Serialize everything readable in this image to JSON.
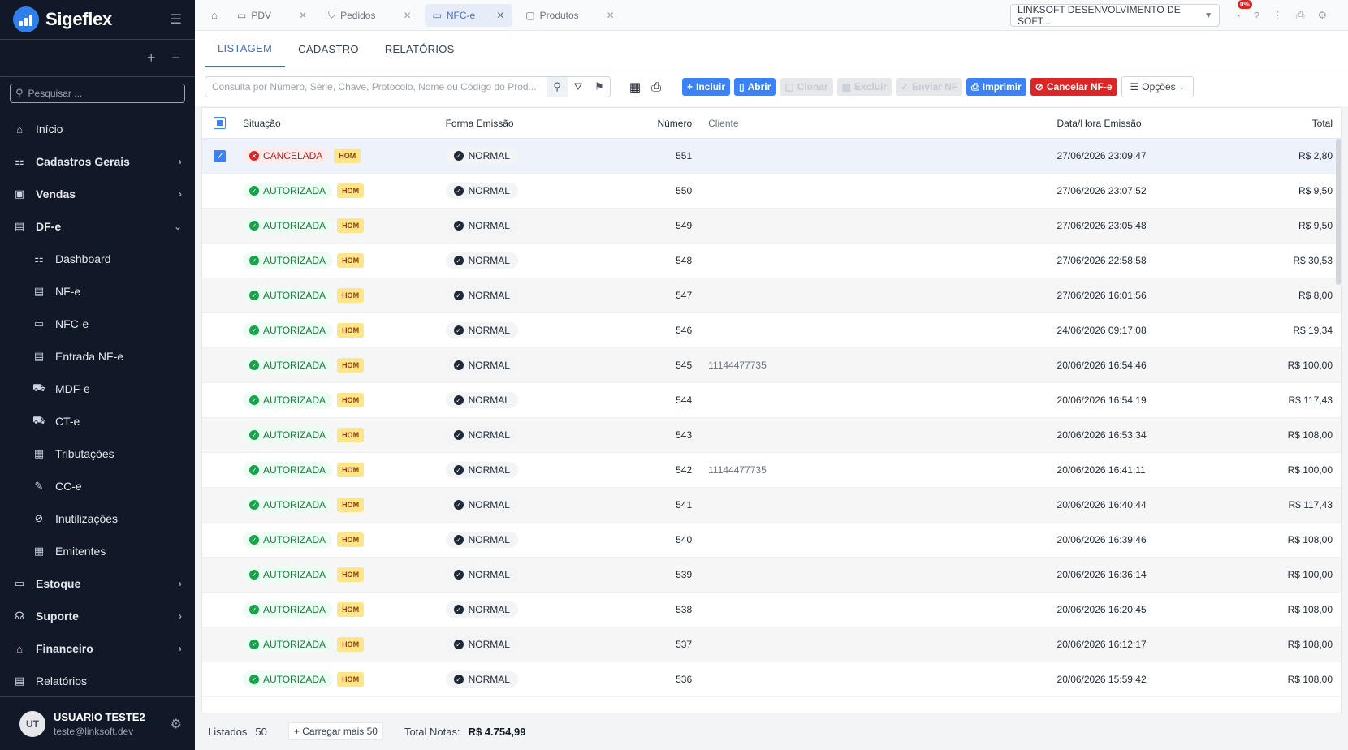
{
  "app": {
    "name": "Sigeflex"
  },
  "sidebar": {
    "search_placeholder": "Pesquisar ...",
    "items": [
      {
        "label": "Início",
        "name": "sidebar-item-inicio",
        "icon": "⌂",
        "bold": false,
        "sub": false,
        "chev": ""
      },
      {
        "label": "Cadastros Gerais",
        "name": "sidebar-item-cadastros-gerais",
        "icon": "⚏",
        "bold": true,
        "sub": false,
        "chev": "›"
      },
      {
        "label": "Vendas",
        "name": "sidebar-item-vendas",
        "icon": "▣",
        "bold": true,
        "sub": false,
        "chev": "›"
      },
      {
        "label": "DF-e",
        "name": "sidebar-item-dfe",
        "icon": "▤",
        "bold": true,
        "sub": false,
        "chev": "⌄"
      },
      {
        "label": "Dashboard",
        "name": "sidebar-item-dashboard",
        "icon": "⚏",
        "bold": false,
        "sub": true,
        "chev": ""
      },
      {
        "label": "NF-e",
        "name": "sidebar-item-nfe",
        "icon": "▤",
        "bold": false,
        "sub": true,
        "chev": ""
      },
      {
        "label": "NFC-e",
        "name": "sidebar-item-nfce",
        "icon": "▭",
        "bold": false,
        "sub": true,
        "chev": ""
      },
      {
        "label": "Entrada NF-e",
        "name": "sidebar-item-entrada-nfe",
        "icon": "▤",
        "bold": false,
        "sub": true,
        "chev": ""
      },
      {
        "label": "MDF-e",
        "name": "sidebar-item-mdfe",
        "icon": "⛟",
        "bold": false,
        "sub": true,
        "chev": ""
      },
      {
        "label": "CT-e",
        "name": "sidebar-item-cte",
        "icon": "⛟",
        "bold": false,
        "sub": true,
        "chev": ""
      },
      {
        "label": "Tributações",
        "name": "sidebar-item-tributacoes",
        "icon": "▦",
        "bold": false,
        "sub": true,
        "chev": ""
      },
      {
        "label": "CC-e",
        "name": "sidebar-item-cce",
        "icon": "✎",
        "bold": false,
        "sub": true,
        "chev": ""
      },
      {
        "label": "Inutilizações",
        "name": "sidebar-item-inutilizacoes",
        "icon": "⊘",
        "bold": false,
        "sub": true,
        "chev": ""
      },
      {
        "label": "Emitentes",
        "name": "sidebar-item-emitentes",
        "icon": "▦",
        "bold": false,
        "sub": true,
        "chev": ""
      },
      {
        "label": "Estoque",
        "name": "sidebar-item-estoque",
        "icon": "▭",
        "bold": true,
        "sub": false,
        "chev": "›"
      },
      {
        "label": "Suporte",
        "name": "sidebar-item-suporte",
        "icon": "☊",
        "bold": true,
        "sub": false,
        "chev": "›"
      },
      {
        "label": "Financeiro",
        "name": "sidebar-item-financeiro",
        "icon": "⌂",
        "bold": true,
        "sub": false,
        "chev": "›"
      },
      {
        "label": "Relatórios",
        "name": "sidebar-item-relatorios",
        "icon": "▤",
        "bold": false,
        "sub": false,
        "chev": ""
      }
    ],
    "user": {
      "initials": "UT",
      "name": "USUARIO TESTE2",
      "email": "teste@linksoft.dev"
    }
  },
  "topbar": {
    "tabs": [
      {
        "label": "PDV",
        "icon": "▭",
        "name": "tab-pdv",
        "active": false
      },
      {
        "label": "Pedidos",
        "icon": "⛉",
        "name": "tab-pedidos",
        "active": false
      },
      {
        "label": "NFC-e",
        "icon": "▭",
        "name": "tab-nfce",
        "active": true
      },
      {
        "label": "Produtos",
        "icon": "▢",
        "name": "tab-produtos",
        "active": false
      }
    ],
    "company": "LINKSOFT DESENVOLVIMENTO DE SOFT...",
    "notif_badge": "0%"
  },
  "module_tabs": [
    "LISTAGEM",
    "CADASTRO",
    "RELATÓRIOS"
  ],
  "toolbar": {
    "search_placeholder": "Consulta por Número, Série, Chave, Protocolo, Nome ou Código do Prod...",
    "buttons": [
      {
        "label": "Incluir",
        "icon": "+",
        "style": "blue",
        "name": "incluir-button"
      },
      {
        "label": "Abrir",
        "icon": "▯",
        "style": "blue",
        "name": "abrir-button"
      },
      {
        "label": "Clonar",
        "icon": "▢",
        "style": "disabled",
        "name": "clonar-button"
      },
      {
        "label": "Excluir",
        "icon": "▥",
        "style": "disabled",
        "name": "excluir-button"
      },
      {
        "label": "Enviar NF",
        "icon": "✓",
        "style": "disabled",
        "name": "enviar-nf-button"
      },
      {
        "label": "Imprimir",
        "icon": "⎙",
        "style": "blue",
        "name": "imprimir-button"
      },
      {
        "label": "Cancelar NF-e",
        "icon": "⊘",
        "style": "red",
        "name": "cancelar-nfe-button"
      }
    ],
    "options_label": "Opções"
  },
  "table": {
    "headers": {
      "situacao": "Situação",
      "forma": "Forma Emissão",
      "numero": "Número",
      "cliente": "Cliente",
      "data": "Data/Hora Emissão",
      "total": "Total"
    },
    "rows": [
      {
        "situacao": "CANCELADA",
        "hom": "HOM",
        "forma": "NORMAL",
        "numero": "551",
        "cliente": "",
        "data": "27/06/2026 23:09:47",
        "total": "R$ 2,80",
        "selected": true
      },
      {
        "situacao": "AUTORIZADA",
        "hom": "HOM",
        "forma": "NORMAL",
        "numero": "550",
        "cliente": "",
        "data": "27/06/2026 23:07:52",
        "total": "R$ 9,50",
        "selected": false
      },
      {
        "situacao": "AUTORIZADA",
        "hom": "HOM",
        "forma": "NORMAL",
        "numero": "549",
        "cliente": "",
        "data": "27/06/2026 23:05:48",
        "total": "R$ 9,50",
        "selected": false
      },
      {
        "situacao": "AUTORIZADA",
        "hom": "HOM",
        "forma": "NORMAL",
        "numero": "548",
        "cliente": "",
        "data": "27/06/2026 22:58:58",
        "total": "R$ 30,53",
        "selected": false
      },
      {
        "situacao": "AUTORIZADA",
        "hom": "HOM",
        "forma": "NORMAL",
        "numero": "547",
        "cliente": "",
        "data": "27/06/2026 16:01:56",
        "total": "R$ 8,00",
        "selected": false
      },
      {
        "situacao": "AUTORIZADA",
        "hom": "HOM",
        "forma": "NORMAL",
        "numero": "546",
        "cliente": "",
        "data": "24/06/2026 09:17:08",
        "total": "R$ 19,34",
        "selected": false
      },
      {
        "situacao": "AUTORIZADA",
        "hom": "HOM",
        "forma": "NORMAL",
        "numero": "545",
        "cliente": "11144477735",
        "data": "20/06/2026 16:54:46",
        "total": "R$ 100,00",
        "selected": false
      },
      {
        "situacao": "AUTORIZADA",
        "hom": "HOM",
        "forma": "NORMAL",
        "numero": "544",
        "cliente": "",
        "data": "20/06/2026 16:54:19",
        "total": "R$ 117,43",
        "selected": false
      },
      {
        "situacao": "AUTORIZADA",
        "hom": "HOM",
        "forma": "NORMAL",
        "numero": "543",
        "cliente": "",
        "data": "20/06/2026 16:53:34",
        "total": "R$ 108,00",
        "selected": false
      },
      {
        "situacao": "AUTORIZADA",
        "hom": "HOM",
        "forma": "NORMAL",
        "numero": "542",
        "cliente": "11144477735",
        "data": "20/06/2026 16:41:11",
        "total": "R$ 100,00",
        "selected": false
      },
      {
        "situacao": "AUTORIZADA",
        "hom": "HOM",
        "forma": "NORMAL",
        "numero": "541",
        "cliente": "",
        "data": "20/06/2026 16:40:44",
        "total": "R$ 117,43",
        "selected": false
      },
      {
        "situacao": "AUTORIZADA",
        "hom": "HOM",
        "forma": "NORMAL",
        "numero": "540",
        "cliente": "",
        "data": "20/06/2026 16:39:46",
        "total": "R$ 108,00",
        "selected": false
      },
      {
        "situacao": "AUTORIZADA",
        "hom": "HOM",
        "forma": "NORMAL",
        "numero": "539",
        "cliente": "",
        "data": "20/06/2026 16:36:14",
        "total": "R$ 100,00",
        "selected": false
      },
      {
        "situacao": "AUTORIZADA",
        "hom": "HOM",
        "forma": "NORMAL",
        "numero": "538",
        "cliente": "",
        "data": "20/06/2026 16:20:45",
        "total": "R$ 108,00",
        "selected": false
      },
      {
        "situacao": "AUTORIZADA",
        "hom": "HOM",
        "forma": "NORMAL",
        "numero": "537",
        "cliente": "",
        "data": "20/06/2026 16:12:17",
        "total": "R$ 108,00",
        "selected": false
      },
      {
        "situacao": "AUTORIZADA",
        "hom": "HOM",
        "forma": "NORMAL",
        "numero": "536",
        "cliente": "",
        "data": "20/06/2026 15:59:42",
        "total": "R$ 108,00",
        "selected": false
      }
    ]
  },
  "footer": {
    "listados_label": "Listados",
    "listados_count": "50",
    "load_more": "Carregar mais 50",
    "total_label": "Total Notas:",
    "total_value": "R$ 4.754,99"
  }
}
